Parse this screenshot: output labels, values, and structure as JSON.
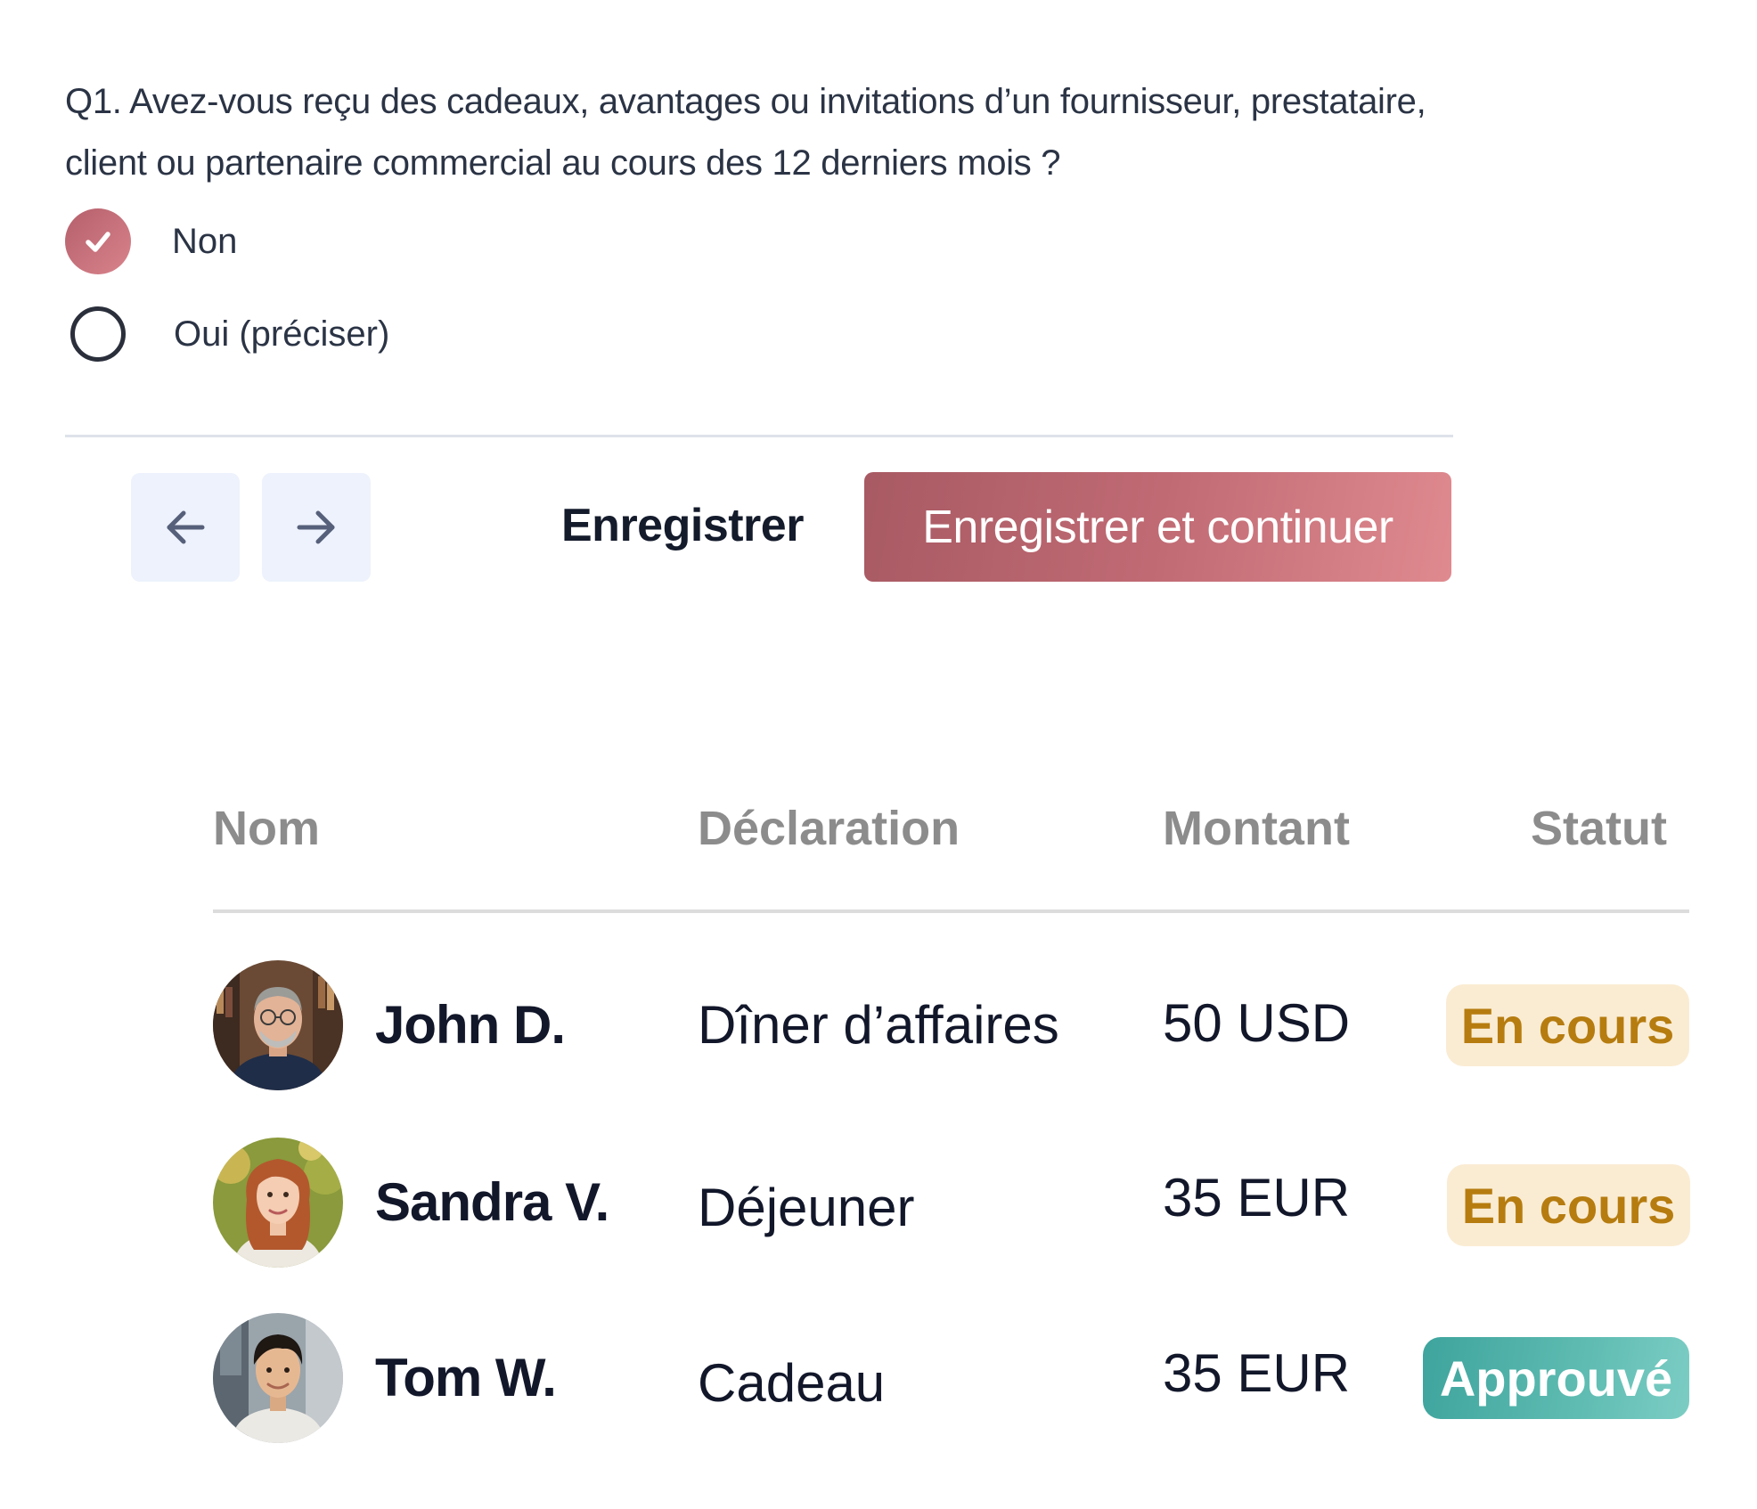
{
  "question": {
    "text": "Q1. Avez-vous reçu des cadeaux, avantages ou invitations d’un fournisseur, prestataire, client ou partenaire commercial au cours des 12 derniers mois ?",
    "options": [
      {
        "label": "Non",
        "selected": true
      },
      {
        "label": "Oui (préciser)",
        "selected": false
      }
    ]
  },
  "actions": {
    "prev_icon": "arrow-left-icon",
    "next_icon": "arrow-right-icon",
    "save_label": "Enregistrer",
    "save_continue_label": "Enregistrer et continuer",
    "accent_color": "#c06a74"
  },
  "table": {
    "headers": {
      "name": "Nom",
      "declaration": "Déclaration",
      "amount": "Montant",
      "status": "Statut"
    },
    "rows": [
      {
        "name": "John D.",
        "declaration": "Dîner d’affaires",
        "amount": "50 USD",
        "status": "En cours",
        "status_type": "pending"
      },
      {
        "name": "Sandra V.",
        "declaration": "Déjeuner",
        "amount": "35 EUR",
        "status": "En cours",
        "status_type": "pending"
      },
      {
        "name": "Tom W.",
        "declaration": "Cadeau",
        "amount": "35 EUR",
        "status": "Approuvé",
        "status_type": "approved"
      }
    ],
    "status_colors": {
      "pending_bg": "#faecd3",
      "pending_text": "#b67c0f",
      "approved_bg": "#5fbcb2",
      "approved_text": "#ffffff"
    }
  }
}
